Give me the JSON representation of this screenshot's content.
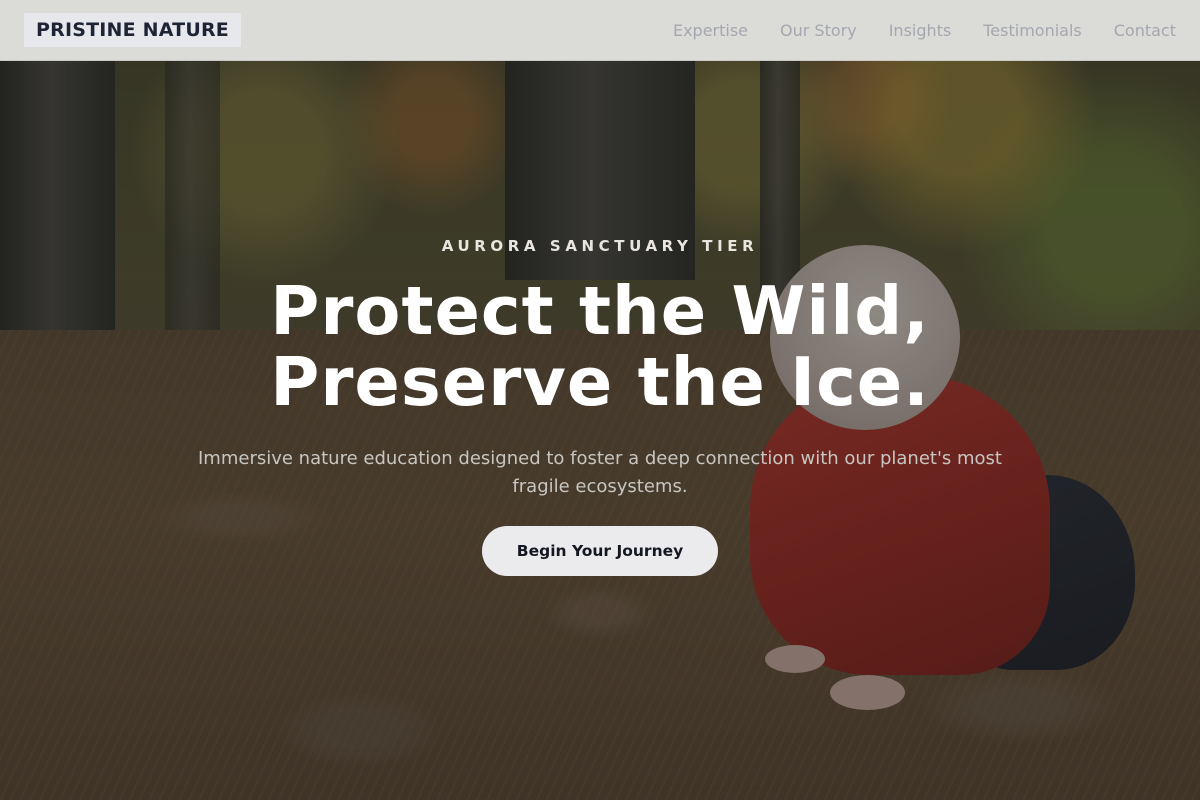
{
  "brand": {
    "name": "PRISTINE NATURE"
  },
  "nav": {
    "links": [
      {
        "label": "Expertise"
      },
      {
        "label": "Our Story"
      },
      {
        "label": "Insights"
      },
      {
        "label": "Testimonials"
      },
      {
        "label": "Contact"
      }
    ]
  },
  "hero": {
    "eyebrow": "AURORA SANCTUARY TIER",
    "headline_line1": "Protect the Wild,",
    "headline_line2": "Preserve the Ice.",
    "subtext": "Immersive nature education designed to foster a deep connection with our planet's most fragile ecosystems.",
    "cta_label": "Begin Your Journey",
    "background_image": "forest floor with crawling child in red jacket"
  },
  "colors": {
    "brand_text": "#1e2436",
    "nav_text": "#a4a7ae",
    "cta_bg": "#ebebee",
    "cta_text": "#141722"
  }
}
